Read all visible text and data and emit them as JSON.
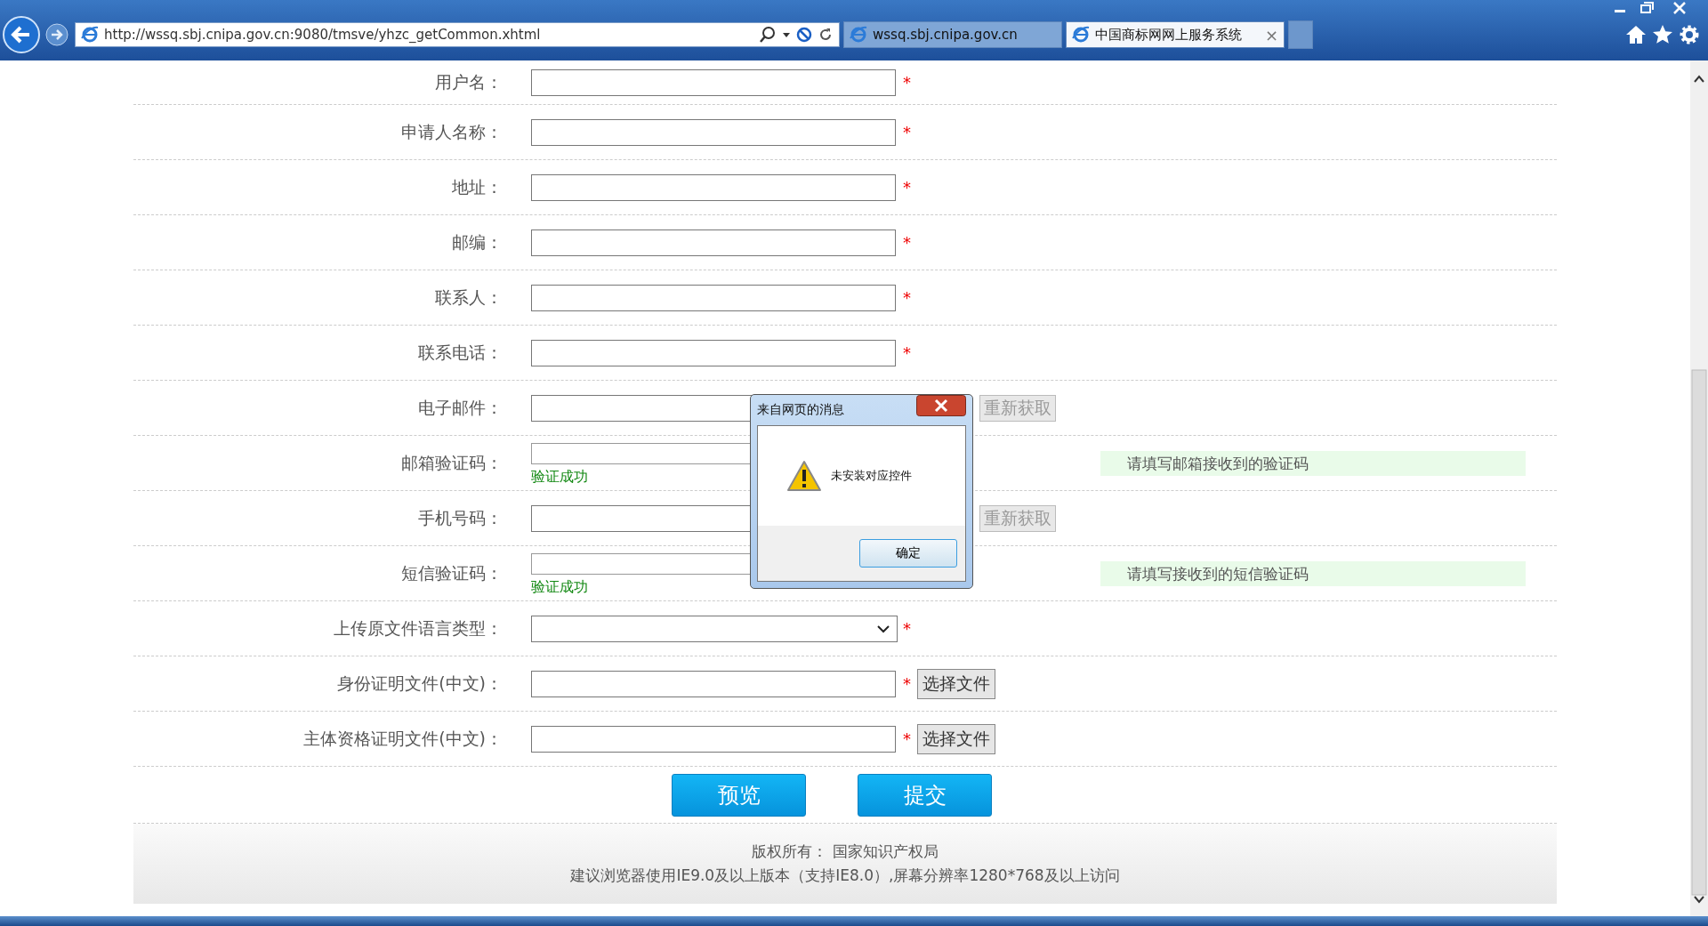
{
  "browser": {
    "address": "http://wssq.sbj.cnipa.gov.cn:9080/tmsve/yhzc_getCommon.xhtml",
    "tabs": [
      {
        "title": "wssq.sbj.cnipa.gov.cn",
        "selected": false
      },
      {
        "title": "中国商标网网上服务系统",
        "selected": true,
        "close": "×"
      }
    ]
  },
  "form": {
    "required_mark": "*",
    "rows": [
      {
        "kind": "text",
        "label": "用户名：",
        "required": true
      },
      {
        "kind": "text",
        "label": "申请人名称：",
        "required": true
      },
      {
        "kind": "text",
        "label": "地址：",
        "required": true
      },
      {
        "kind": "text",
        "label": "邮编：",
        "required": true
      },
      {
        "kind": "text",
        "label": "联系人：",
        "required": true
      },
      {
        "kind": "text",
        "label": "联系电话：",
        "required": true
      },
      {
        "kind": "resend",
        "label": "电子邮件：",
        "button": "重新获取",
        "disabled": true
      },
      {
        "kind": "code",
        "label": "邮箱验证码：",
        "status": "验证成功",
        "hint": "请填写邮箱接收到的验证码"
      },
      {
        "kind": "resend",
        "label": "手机号码：",
        "button": "重新获取",
        "disabled": true
      },
      {
        "kind": "code",
        "label": "短信验证码：",
        "status": "验证成功",
        "hint": "请填写接收到的短信验证码"
      },
      {
        "kind": "select",
        "label": "上传原文件语言类型：",
        "required": true
      },
      {
        "kind": "file",
        "label": "身份证明文件(中文)：",
        "required": true,
        "button": "选择文件"
      },
      {
        "kind": "file",
        "label": "主体资格证明文件(中文)：",
        "required": true,
        "button": "选择文件"
      }
    ]
  },
  "buttons": [
    "预览",
    "提交"
  ],
  "footer": [
    "版权所有： 国家知识产权局",
    "建议浏览器使用IE9.0及以上版本（支持IE8.0）,屏幕分辨率1280*768及以上访问"
  ],
  "dialog": {
    "title": "来自网页的消息",
    "message": "未安装对应控件",
    "ok": "确定"
  }
}
